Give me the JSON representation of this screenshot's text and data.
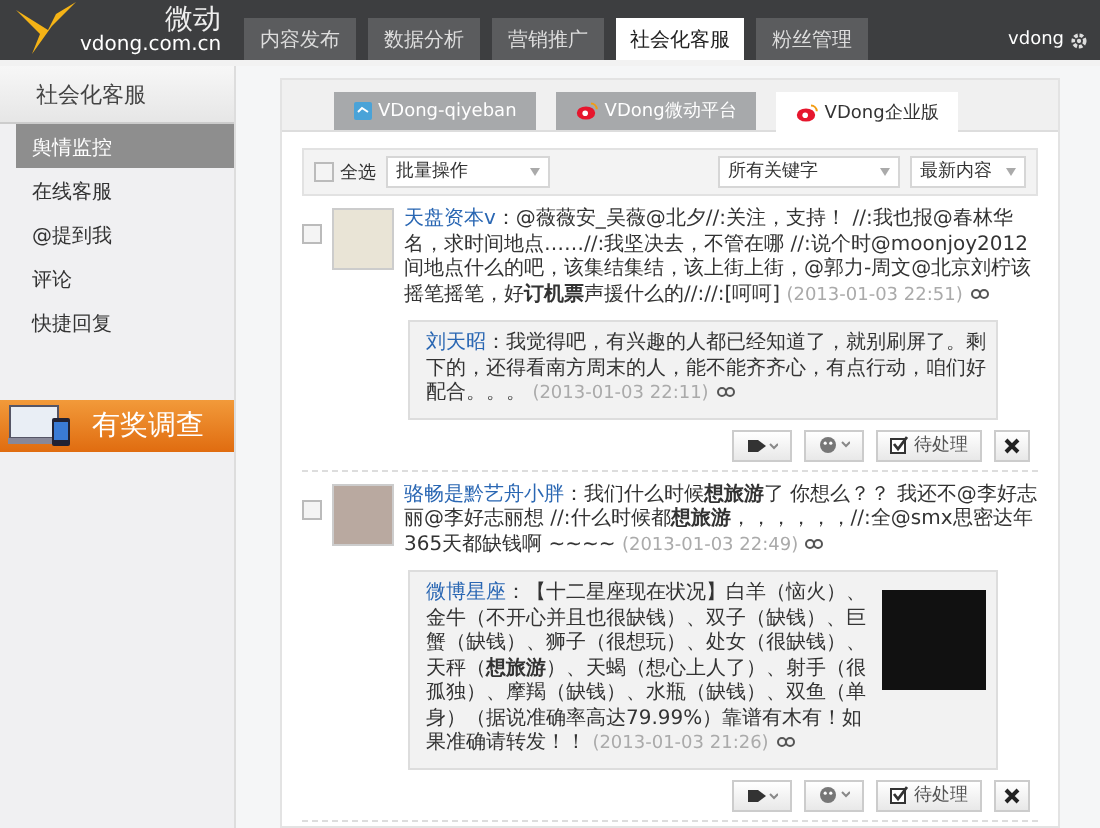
{
  "header": {
    "logo_text": "微动",
    "logo_domain": "vdong.com.cn",
    "user": "vdong",
    "nav_tabs": [
      {
        "label": "内容发布",
        "selected": false
      },
      {
        "label": "数据分析",
        "selected": false
      },
      {
        "label": "营销推广",
        "selected": false
      },
      {
        "label": "社会化客服",
        "selected": true
      },
      {
        "label": "粉丝管理",
        "selected": false
      }
    ]
  },
  "sidebar": {
    "title": "社会化客服",
    "banner": "有奖调查",
    "items": [
      {
        "label": "舆情监控",
        "selected": true
      },
      {
        "label": "在线客服",
        "selected": false
      },
      {
        "label": "@提到我",
        "selected": false
      },
      {
        "label": "评论",
        "selected": false
      },
      {
        "label": "快捷回复",
        "selected": false
      }
    ]
  },
  "account_tabs": [
    {
      "label": "VDong-qiyeban",
      "kind": "square",
      "selected": false
    },
    {
      "label": "VDong微动平台",
      "kind": "weibo",
      "selected": false
    },
    {
      "label": "VDong企业版",
      "kind": "weibo",
      "selected": true
    }
  ],
  "toolbar": {
    "select_all": {
      "label": "全选",
      "checked": false
    },
    "batch_select": "批量操作",
    "keyword_select": "所有关键字",
    "sort_select": "最新内容"
  },
  "posts": [
    {
      "checked": false,
      "author": "天盘资本v",
      "text": "：@薇薇安_吴薇@北夕//:关注，支持！ //:我也报@春林华名，求时间地点……//:我坚决去，不管在哪 //:说个时@moonjoy2012间地点什么的吧，该集结集结，该上街上街，@郭力-周文@北京刘柠该摇笔摇笔，好**订机票**声援什么的//://:[呵呵]",
      "time": "(2013-01-03 22:51)",
      "quote": {
        "author": "刘天昭",
        "text": "：我觉得吧，有兴趣的人都已经知道了，就别刷屏了。剩下的，还得看南方周末的人，能不能齐齐心，有点行动，咱们好配合。。。",
        "time": "(2013-01-03 22:11)",
        "has_image": false
      },
      "status_button": "待处理"
    },
    {
      "checked": false,
      "author": "骆畅是黔艺舟小胖",
      "text": "：我们什么时候**想旅游**了 你想么？？ 我还不@李好志丽@李好志丽想 //:什么时候都**想旅游**，，，，，，//:全@smx思密达年365天都缺钱啊 ~~~~",
      "time": "(2013-01-03 22:49)",
      "quote": {
        "author": "微博星座",
        "text": "：【十二星座现在状况】白羊（恼火）、金牛（不开心并且也很缺钱）、双子（缺钱）、巨蟹（缺钱）、狮子（很想玩）、处女（很缺钱）、天秤（**想旅游**）、天蝎（想心上人了）、射手（很孤独）、摩羯（缺钱）、水瓶（缺钱）、双鱼（单身）（据说准确率高达79.99%）靠谱有木有！如果准确请转发！！",
        "time": "(2013-01-03 21:26)",
        "has_image": true
      },
      "status_button": "待处理"
    }
  ]
}
